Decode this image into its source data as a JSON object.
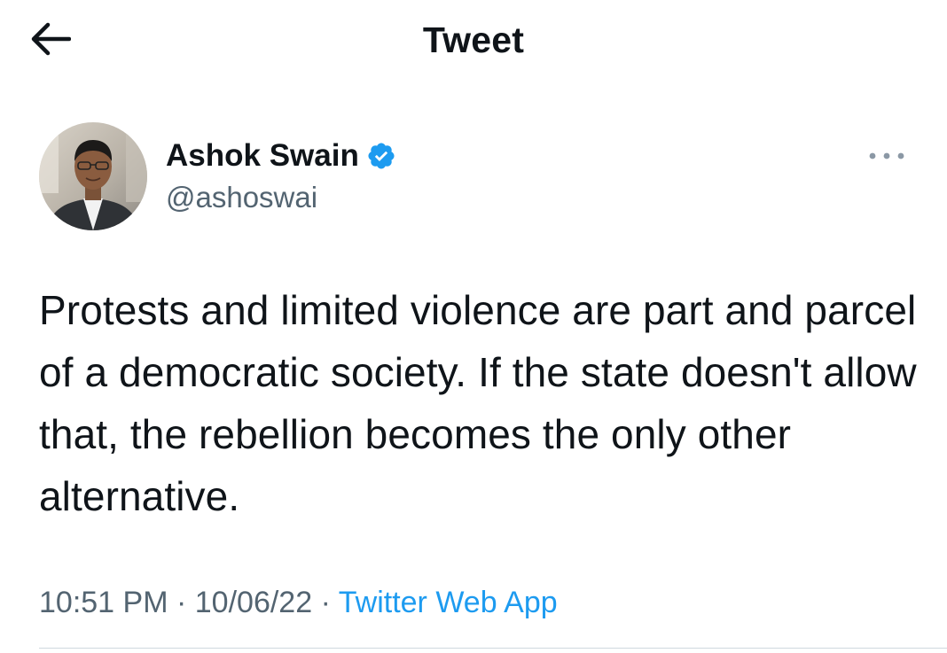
{
  "header": {
    "back_icon": "arrow-left-icon",
    "title": "Tweet"
  },
  "tweet": {
    "author": {
      "name": "Ashok Swain",
      "verified": true,
      "verified_icon": "verified-badge-icon",
      "handle": "@ashoswai"
    },
    "more_icon": "more-horizontal-icon",
    "text": "Protests and limited violence are part and parcel of a democratic society. If the state doesn't allow that, the rebellion becomes the only other alternative.",
    "time": "10:51 PM",
    "separator": "·",
    "date": "10/06/22",
    "source": "Twitter Web App"
  },
  "colors": {
    "text_primary": "#0f1419",
    "text_secondary": "#536471",
    "accent": "#1d9bf0",
    "divider": "#cfd9de"
  }
}
